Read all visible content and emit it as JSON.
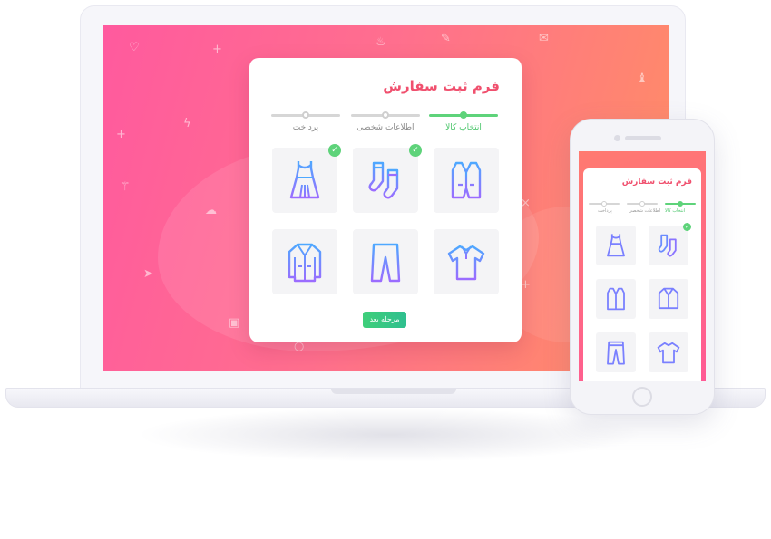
{
  "desktop": {
    "title": "فرم ثبت سفارش",
    "steps": [
      {
        "label": "انتخاب کالا",
        "state": "active"
      },
      {
        "label": "اطلاعات شخصی",
        "state": "pending"
      },
      {
        "label": "پرداخت",
        "state": "pending"
      }
    ],
    "products": [
      {
        "icon": "vest-icon",
        "selected": false
      },
      {
        "icon": "socks-icon",
        "selected": true
      },
      {
        "icon": "dress-icon",
        "selected": true
      },
      {
        "icon": "polo-shirt-icon",
        "selected": false
      },
      {
        "icon": "pants-icon",
        "selected": false
      },
      {
        "icon": "coat-icon",
        "selected": false
      }
    ],
    "next_button": "مرحله بعد"
  },
  "mobile": {
    "title": "فرم ثبت سفارش",
    "steps": [
      {
        "label": "انتخاب کالا",
        "state": "active"
      },
      {
        "label": "اطلاعات شخصی",
        "state": "pending"
      },
      {
        "label": "پرداخت",
        "state": "pending"
      }
    ],
    "products": [
      {
        "icon": "socks-icon",
        "selected": true
      },
      {
        "icon": "dress-icon",
        "selected": false
      },
      {
        "icon": "coat-icon",
        "selected": false
      },
      {
        "icon": "vest-icon",
        "selected": false
      },
      {
        "icon": "polo-shirt-icon",
        "selected": false
      },
      {
        "icon": "pants-icon",
        "selected": false
      }
    ]
  },
  "colors": {
    "title": "#f0506e",
    "step_active": "#5ed37a",
    "gradient_start": "#ff5a9e",
    "gradient_end": "#ff8f63"
  }
}
